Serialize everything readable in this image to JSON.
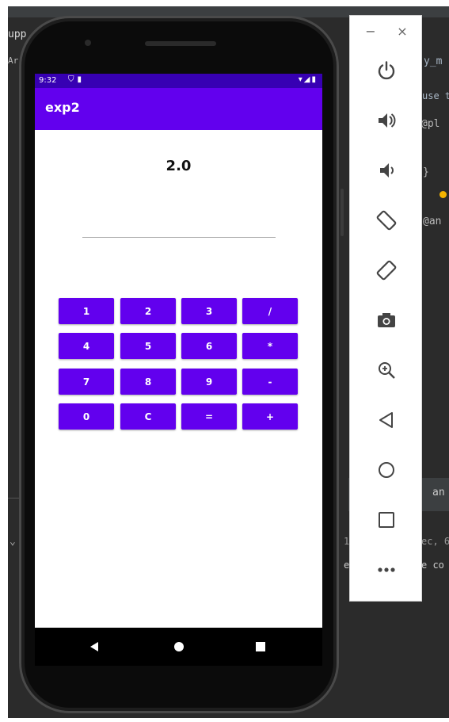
{
  "ide": {
    "fragments": [
      "upp",
      "Ar",
      "y_m",
      "use t",
      "@pl",
      "}",
      "@an",
      "an",
      "ec, 6",
      "e co",
      "1",
      "e"
    ]
  },
  "device": {
    "status_bar": {
      "time": "9:32"
    },
    "app": {
      "title": "exp2",
      "result": "2.0",
      "input_value": "",
      "keys": [
        [
          "1",
          "2",
          "3",
          "/"
        ],
        [
          "4",
          "5",
          "6",
          "*"
        ],
        [
          "7",
          "8",
          "9",
          "-"
        ],
        [
          "0",
          "C",
          "=",
          "+"
        ]
      ]
    }
  },
  "controls": {
    "minimize_label": "−",
    "close_label": "×",
    "buttons": [
      "power",
      "volume-up",
      "volume-down",
      "rotate-left",
      "rotate-right",
      "camera",
      "zoom",
      "back",
      "home",
      "overview",
      "more"
    ]
  },
  "colors": {
    "primary": "#6200ee",
    "status_bar": "#3700b3",
    "ide_background": "#2b2b2b"
  }
}
